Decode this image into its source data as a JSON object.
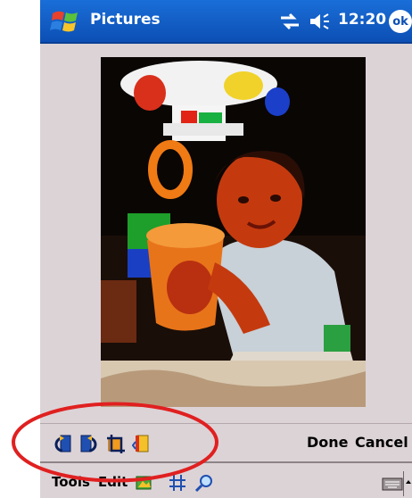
{
  "window": {
    "app_title": "Pictures",
    "clock": "12:20",
    "ok_label": "ok"
  },
  "edit_toolbar": {
    "tools": [
      {
        "icon": "rotate-left-icon"
      },
      {
        "icon": "rotate-right-icon"
      },
      {
        "icon": "crop-icon"
      },
      {
        "icon": "contrast-icon"
      }
    ],
    "done_label": "Done",
    "cancel_label": "Cancel"
  },
  "menubar": {
    "tools_label": "Tools",
    "edit_label": "Edit"
  },
  "colors": {
    "titlebar": "#0c4fb4",
    "background": "#dcd3d7",
    "annotation": "#e02020"
  }
}
